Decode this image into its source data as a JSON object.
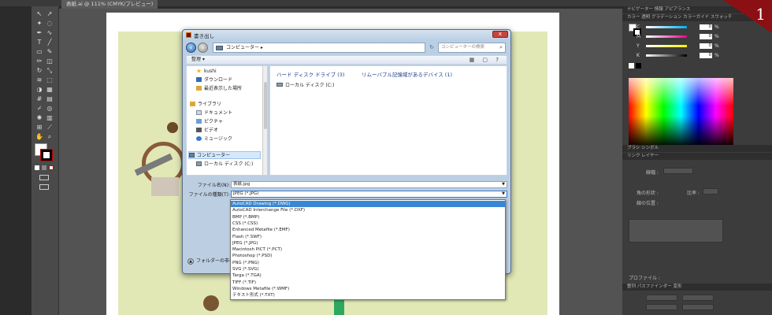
{
  "app": {
    "doc_tab": "表紙.ai @ 111% (CMYK/プレビュー)",
    "badge_number": "1"
  },
  "right_panel": {
    "top_tabs": "ナビゲーター  情報  アピアランス",
    "color_tabs": "カラー  透明  グラデーション  カラーガイド  スウォッチ",
    "sliders": [
      {
        "label": "C",
        "value": "0",
        "unit": "%",
        "color": "#00aeef"
      },
      {
        "label": "M",
        "value": "0",
        "unit": "%",
        "color": "#ec008c"
      },
      {
        "label": "Y",
        "value": "0",
        "unit": "%",
        "color": "#fff200"
      },
      {
        "label": "K",
        "value": "0",
        "unit": "%",
        "color": "#888888"
      }
    ],
    "brush_tabs": "ブラシ  シンボル",
    "layer_tabs": "リンク  レイヤー",
    "stroke_label": "線幅 :",
    "cap_label": "角の形状 :",
    "ratio_label": "比率 :",
    "align_label": "線の位置 :",
    "profile_label": "プロファイル :",
    "transform_tabs": "整列  パスファインダー  変形"
  },
  "dialog": {
    "title": "書き出し",
    "close_label": "x",
    "address": "コンピューター ▸",
    "search_placeholder": "コンピューターの検索",
    "organize_label": "整理 ▾",
    "nav_items": [
      {
        "label": "kushi",
        "icon": "star-icon"
      },
      {
        "label": "ダウンロード",
        "icon": "folder-icon"
      },
      {
        "label": "最近表示した場所",
        "icon": "folder-icon"
      },
      {
        "label": "ライブラリ",
        "icon": "library-icon"
      },
      {
        "label": "ドキュメント",
        "icon": "document-icon"
      },
      {
        "label": "ピクチャ",
        "icon": "picture-icon"
      },
      {
        "label": "ビデオ",
        "icon": "video-icon"
      },
      {
        "label": "ミュージック",
        "icon": "music-icon"
      },
      {
        "label": "コンピューター",
        "icon": "computer-icon"
      },
      {
        "label": "ローカル ディスク (C:)",
        "icon": "drive-icon"
      }
    ],
    "group_hdd": "ハード ディスク ドライブ (3)",
    "group_removable": "リムーバブル記憶域があるデバイス (1)",
    "drive_label": "ローカル ディスク (C:)",
    "filename_label": "ファイル名(N):",
    "filename_value": "表紙.jpg",
    "filetype_label": "ファイルの種類(T):",
    "filetype_value": "JPEG (*.JPG)",
    "folder_toggle": "フォルダーの非表示",
    "filetype_options": [
      "AutoCAD Drawing (*.DWG)",
      "AutoCAD Interchange File (*.DXF)",
      "BMP (*.BMP)",
      "CSS (*.CSS)",
      "Enhanced Metafile (*.EMF)",
      "Flash (*.SWF)",
      "JPEG (*.JPG)",
      "Macintosh PICT (*.PCT)",
      "Photoshop (*.PSD)",
      "PNG (*.PNG)",
      "SVG (*.SVG)",
      "Targa (*.TGA)",
      "TIFF (*.TIF)",
      "Windows Metafile (*.WMF)",
      "テキスト形式 (*.TXT)"
    ],
    "selected_option_index": 0
  }
}
